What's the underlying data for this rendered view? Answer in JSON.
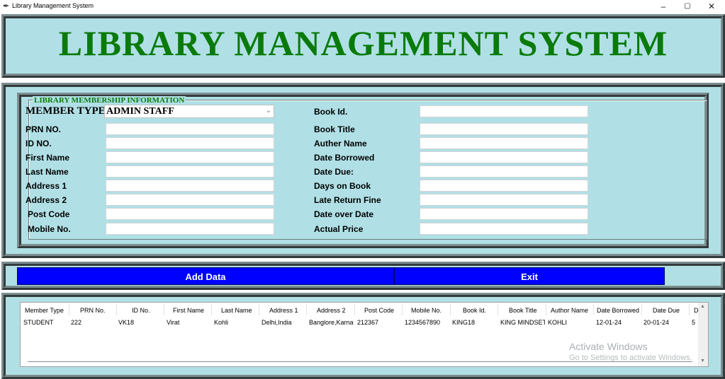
{
  "window": {
    "title": "Library Management System",
    "controls": {
      "minimize": "–",
      "maximize": "▢",
      "close": "✕"
    }
  },
  "header": {
    "title": "LIBRARY MANAGEMENT SYSTEM"
  },
  "membership": {
    "legend": "LIBRARY MEMBERSHIP INFORMATION",
    "member_type_label": "MEMBER TYPE",
    "member_type_value": "ADMIN STAFF",
    "left_fields": [
      {
        "label": "PRN NO.",
        "value": ""
      },
      {
        "label": "ID NO.",
        "value": ""
      },
      {
        "label": "First Name",
        "value": ""
      },
      {
        "label": "Last Name",
        "value": ""
      },
      {
        "label": "Address 1",
        "value": ""
      },
      {
        "label": "Address 2",
        "value": ""
      },
      {
        "label": "Post Code",
        "value": ""
      },
      {
        "label": "Mobile No.",
        "value": ""
      }
    ],
    "right_fields": [
      {
        "label": "Book Id.",
        "value": ""
      },
      {
        "label": "Book Title",
        "value": ""
      },
      {
        "label": "Auther Name",
        "value": ""
      },
      {
        "label": "Date Borrowed",
        "value": ""
      },
      {
        "label": "Date Due:",
        "value": ""
      },
      {
        "label": "Days on Book",
        "value": ""
      },
      {
        "label": "Late Return Fine",
        "value": ""
      },
      {
        "label": "Date over Date",
        "value": ""
      },
      {
        "label": "Actual Price",
        "value": ""
      }
    ]
  },
  "actions": {
    "add_label": "Add Data",
    "exit_label": "Exit"
  },
  "table": {
    "columns": [
      "Member Type",
      "PRN No.",
      "ID No.",
      "First Name",
      "Last Name",
      "Address 1",
      "Address 2",
      "Post Code",
      "Mobile No.",
      "Book Id.",
      "Book Title",
      "Author Name",
      "Date Borrowed",
      "Date Due",
      "Da"
    ],
    "rows": [
      [
        "STUDENT",
        "222",
        "VK18",
        "Virat",
        "Kohli",
        "Delhi,India",
        "Banglore,Karnat",
        "212367",
        "1234567890",
        "KING18",
        "KING MINDSET",
        "KOHLI",
        "12-01-24",
        "20-01-24",
        "5"
      ]
    ]
  },
  "watermark": {
    "line1": "Activate Windows",
    "line2": "Go to Settings to activate Windows."
  },
  "colors": {
    "panel_bg": "#b0e0e6",
    "title_green": "#0a7a0a",
    "button_blue": "#0000ff"
  }
}
